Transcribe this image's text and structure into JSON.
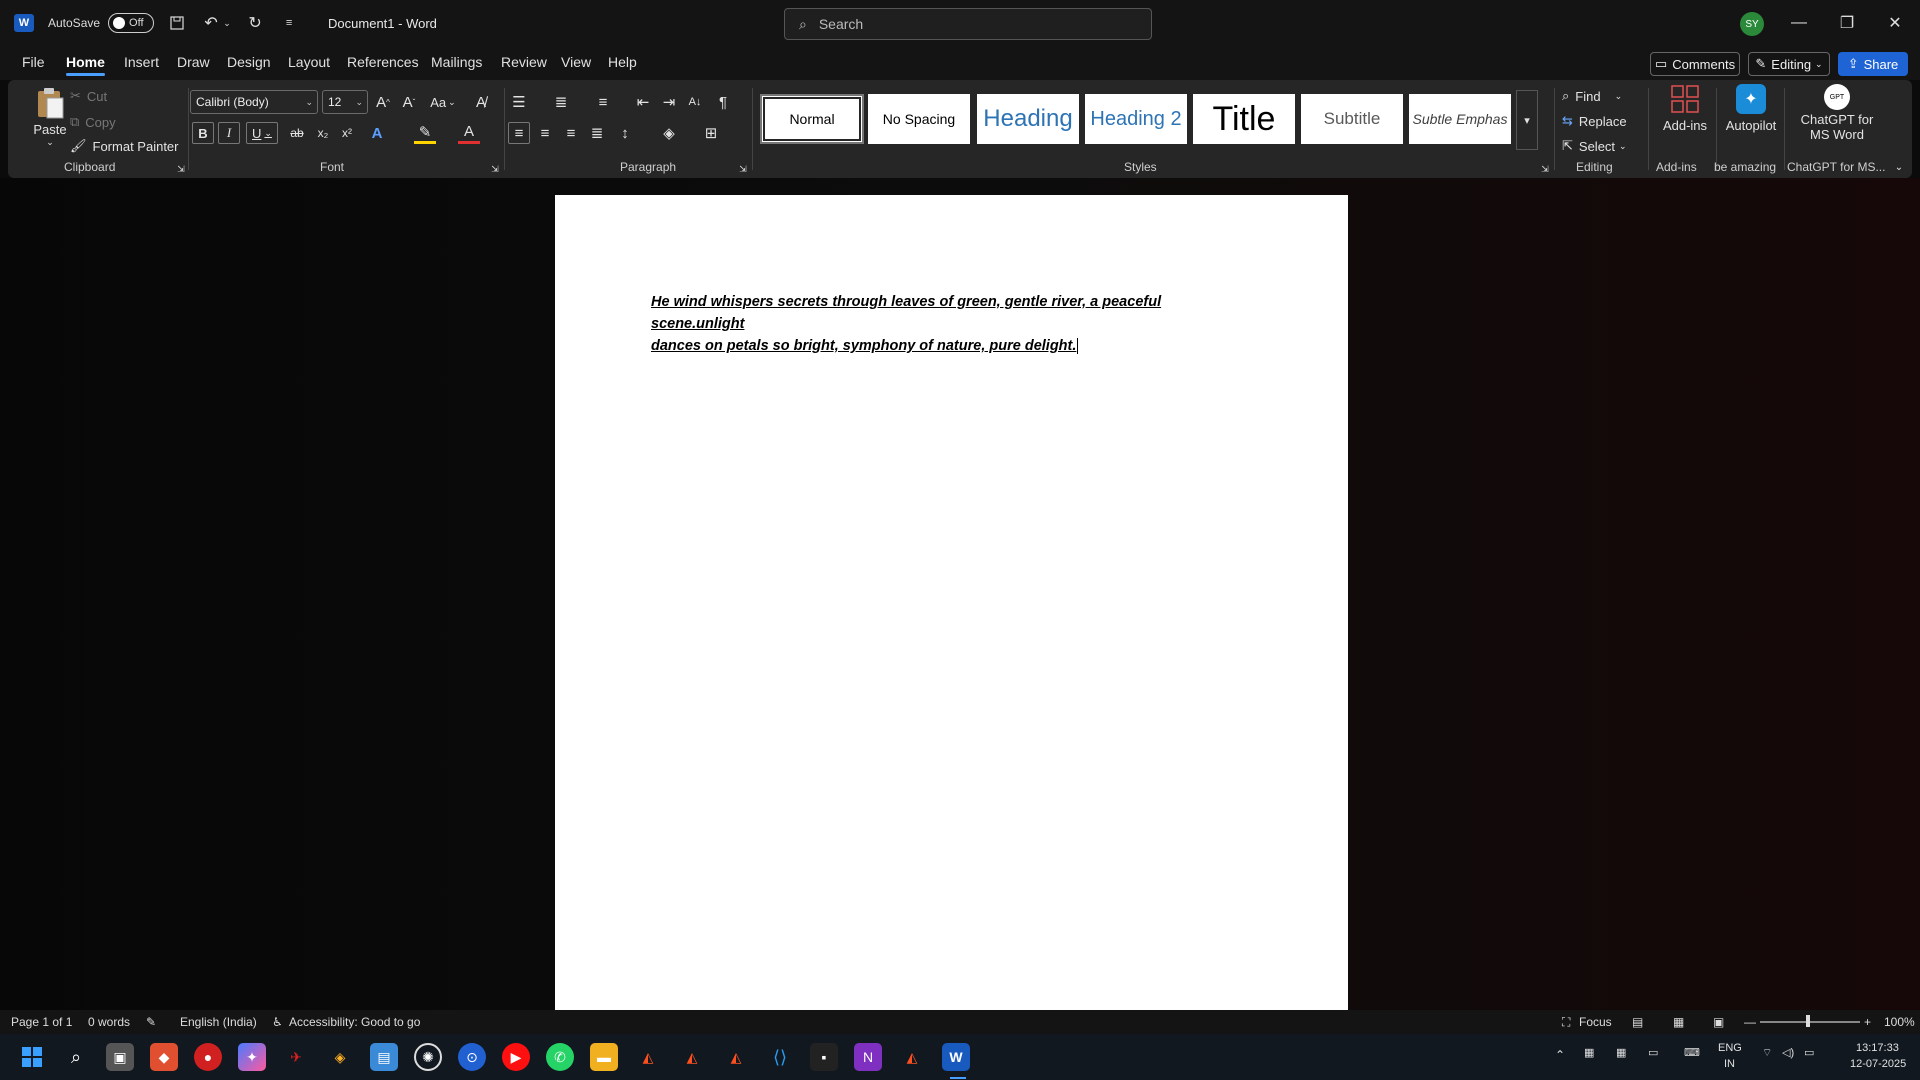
{
  "titlebar": {
    "app_logo": "W",
    "autosave_label": "AutoSave",
    "autosave_state": "Off",
    "document_title": "Document1 - Word",
    "search_placeholder": "Search",
    "user_initials": "SY"
  },
  "menu": {
    "tabs": [
      "File",
      "Home",
      "Insert",
      "Draw",
      "Design",
      "Layout",
      "References",
      "Mailings",
      "Review",
      "View",
      "Help"
    ],
    "active_tab": "Home",
    "comments_label": "Comments",
    "editing_label": "Editing",
    "share_label": "Share"
  },
  "ribbon": {
    "clipboard": {
      "paste": "Paste",
      "cut": "Cut",
      "copy": "Copy",
      "format_painter": "Format Painter",
      "group_label": "Clipboard"
    },
    "font": {
      "font_name": "Calibri (Body)",
      "font_size": "12",
      "group_label": "Font",
      "change_case": "Aa"
    },
    "paragraph": {
      "group_label": "Paragraph"
    },
    "styles": {
      "items": [
        "Normal",
        "No Spacing",
        "Heading",
        "Heading 2",
        "Title",
        "Subtitle",
        "Subtle Emphas"
      ],
      "group_label": "Styles"
    },
    "editing": {
      "find": "Find",
      "replace": "Replace",
      "select": "Select",
      "group_label": "Editing"
    },
    "addins": {
      "label": "Add-ins",
      "group_label": "Add-ins"
    },
    "autopilot": {
      "label": "Autopilot",
      "group_label": "be amazing"
    },
    "chatgpt": {
      "label_line1": "ChatGPT for",
      "label_line2": "MS Word",
      "group_label": "ChatGPT for MS..."
    }
  },
  "document": {
    "text_line1": "He wind whispers secrets through leaves of green, gentle river, a peaceful scene.unlight",
    "text_line2": "dances on petals so bright, symphony of nature, pure delight."
  },
  "statusbar": {
    "page": "Page 1 of 1",
    "words": "0 words",
    "language": "English (India)",
    "accessibility": "Accessibility: Good to go",
    "focus": "Focus",
    "zoom": "100%"
  },
  "taskbar": {
    "lang_line1": "ENG",
    "lang_line2": "IN",
    "time": "13:17:33",
    "date": "12-07-2025"
  },
  "colors": {
    "accent_blue": "#1f64d4",
    "word_blue": "#185abd",
    "avatar_green": "#2a8a3a"
  }
}
